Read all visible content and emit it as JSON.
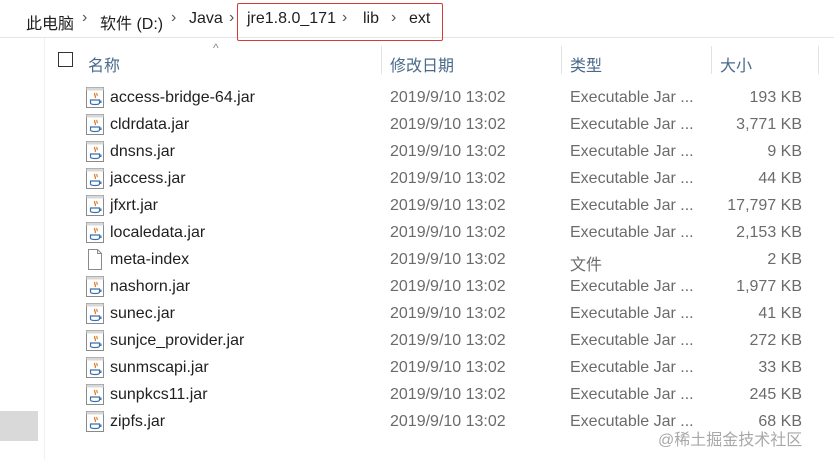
{
  "breadcrumb": [
    "此电脑",
    "软件 (D:)",
    "Java",
    "jre1.8.0_171",
    "lib",
    "ext"
  ],
  "columns": {
    "name": "名称",
    "date": "修改日期",
    "type": "类型",
    "size": "大小"
  },
  "files": [
    {
      "name": "access-bridge-64.jar",
      "date": "2019/9/10 13:02",
      "type": "Executable Jar ...",
      "size": "193 KB",
      "icon": "java-jar-icon"
    },
    {
      "name": "cldrdata.jar",
      "date": "2019/9/10 13:02",
      "type": "Executable Jar ...",
      "size": "3,771 KB",
      "icon": "java-jar-icon"
    },
    {
      "name": "dnsns.jar",
      "date": "2019/9/10 13:02",
      "type": "Executable Jar ...",
      "size": "9 KB",
      "icon": "java-jar-icon"
    },
    {
      "name": "jaccess.jar",
      "date": "2019/9/10 13:02",
      "type": "Executable Jar ...",
      "size": "44 KB",
      "icon": "java-jar-icon"
    },
    {
      "name": "jfxrt.jar",
      "date": "2019/9/10 13:02",
      "type": "Executable Jar ...",
      "size": "17,797 KB",
      "icon": "java-jar-icon"
    },
    {
      "name": "localedata.jar",
      "date": "2019/9/10 13:02",
      "type": "Executable Jar ...",
      "size": "2,153 KB",
      "icon": "java-jar-icon"
    },
    {
      "name": "meta-index",
      "date": "2019/9/10 13:02",
      "type": "文件",
      "size": "2 KB",
      "icon": "file-icon"
    },
    {
      "name": "nashorn.jar",
      "date": "2019/9/10 13:02",
      "type": "Executable Jar ...",
      "size": "1,977 KB",
      "icon": "java-jar-icon"
    },
    {
      "name": "sunec.jar",
      "date": "2019/9/10 13:02",
      "type": "Executable Jar ...",
      "size": "41 KB",
      "icon": "java-jar-icon"
    },
    {
      "name": "sunjce_provider.jar",
      "date": "2019/9/10 13:02",
      "type": "Executable Jar ...",
      "size": "272 KB",
      "icon": "java-jar-icon"
    },
    {
      "name": "sunmscapi.jar",
      "date": "2019/9/10 13:02",
      "type": "Executable Jar ...",
      "size": "33 KB",
      "icon": "java-jar-icon"
    },
    {
      "name": "sunpkcs11.jar",
      "date": "2019/9/10 13:02",
      "type": "Executable Jar ...",
      "size": "245 KB",
      "icon": "java-jar-icon"
    },
    {
      "name": "zipfs.jar",
      "date": "2019/9/10 13:02",
      "type": "Executable Jar ...",
      "size": "68 KB",
      "icon": "java-jar-icon"
    }
  ],
  "watermark": "@稀土掘金技术社区",
  "colors": {
    "highlight_border": "#d33a3a",
    "header_text": "#4a6a8a"
  }
}
